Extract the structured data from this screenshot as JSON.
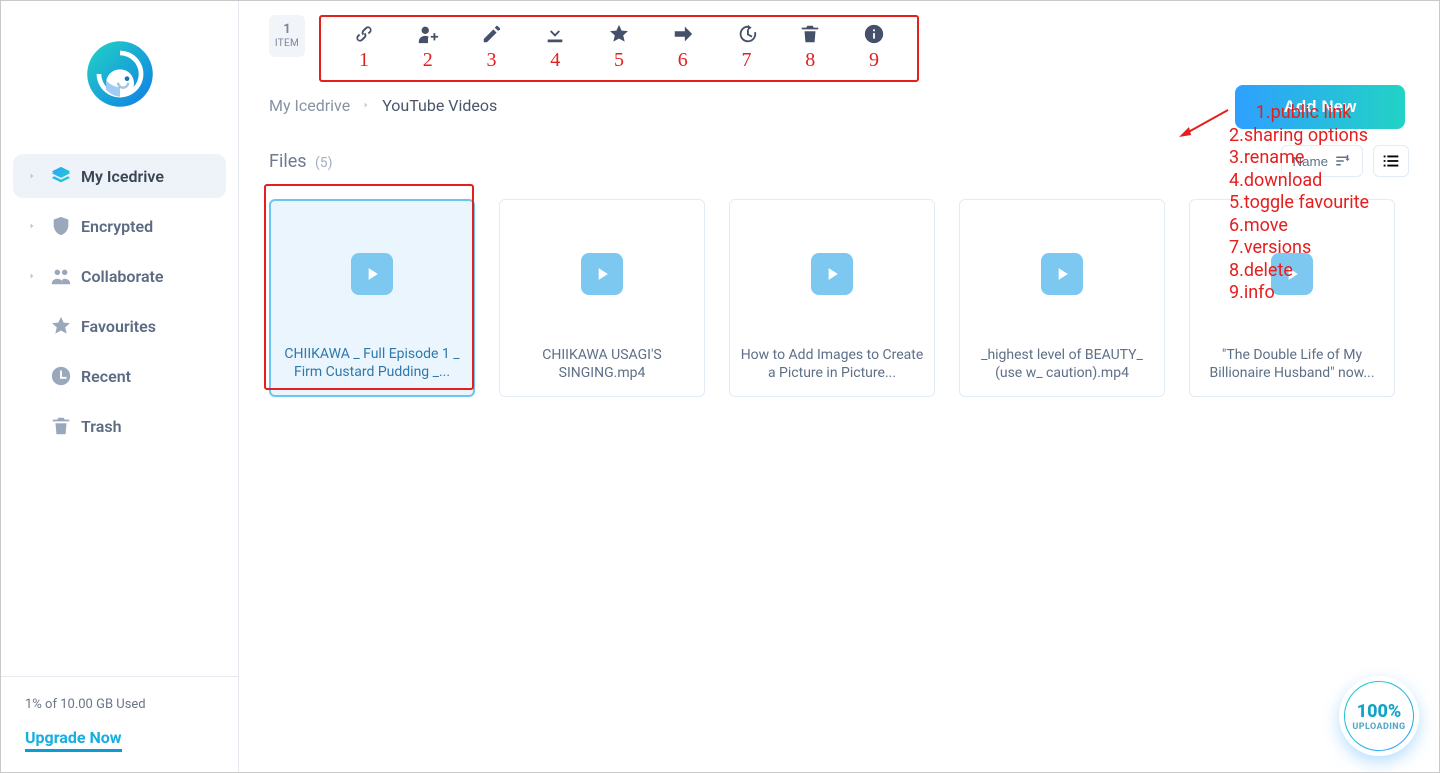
{
  "sidebar": {
    "items": [
      {
        "label": "My Icedrive",
        "icon": "layers-icon",
        "active": true,
        "hasCaret": true
      },
      {
        "label": "Encrypted",
        "icon": "shield-icon",
        "active": false,
        "hasCaret": true
      },
      {
        "label": "Collaborate",
        "icon": "people-icon",
        "active": false,
        "hasCaret": true
      },
      {
        "label": "Favourites",
        "icon": "star-icon",
        "active": false,
        "hasCaret": false
      },
      {
        "label": "Recent",
        "icon": "clock-icon",
        "active": false,
        "hasCaret": false
      },
      {
        "label": "Trash",
        "icon": "trash-icon",
        "active": false,
        "hasCaret": false
      }
    ],
    "quota_text": "1% of 10.00 GB Used",
    "upgrade_label": "Upgrade Now"
  },
  "selection": {
    "count": "1",
    "unit": "ITEM"
  },
  "toolbar": {
    "items": [
      {
        "num": "1",
        "icon": "link-icon"
      },
      {
        "num": "2",
        "icon": "share-user-icon"
      },
      {
        "num": "3",
        "icon": "pencil-icon"
      },
      {
        "num": "4",
        "icon": "download-icon"
      },
      {
        "num": "5",
        "icon": "star-icon"
      },
      {
        "num": "6",
        "icon": "arrow-right-icon"
      },
      {
        "num": "7",
        "icon": "history-icon"
      },
      {
        "num": "8",
        "icon": "trash-icon"
      },
      {
        "num": "9",
        "icon": "info-icon"
      }
    ]
  },
  "breadcrumb": {
    "root": "My Icedrive",
    "current": "YouTube Videos"
  },
  "actions": {
    "add_new": "Add New"
  },
  "files": {
    "header": "Files",
    "count": "(5)",
    "sort_label": "Name",
    "items": [
      {
        "title": "CHIIKAWA _ Full Episode 1 _ Firm Custard Pudding _...",
        "selected": true
      },
      {
        "title": "CHIIKAWA USAGI'S SINGING.mp4",
        "selected": false
      },
      {
        "title": "How to Add Images to Create a Picture in Picture...",
        "selected": false
      },
      {
        "title": "_highest level of BEAUTY_ (use w_ caution).mp4",
        "selected": false
      },
      {
        "title": "\"The Double Life of My Billionaire Husband\" now...",
        "selected": false
      }
    ]
  },
  "annotation": {
    "lines": "1.public link\n2.sharing options\n3.rename\n4.download\n5.toggle favourite\n6.move\n7.versions\n8.delete\n9.info"
  },
  "upload": {
    "percent": "100%",
    "label": "UPLOADING"
  }
}
